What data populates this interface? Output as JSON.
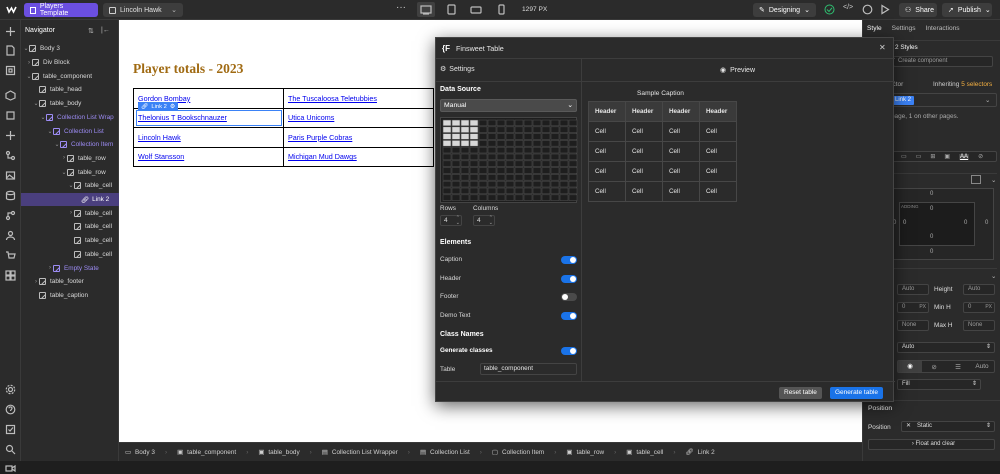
{
  "topbar": {
    "page_name": "Players Template",
    "collection_item": "Lincoln Hawk",
    "width_readout": "1297 PX",
    "mode": "Designing",
    "share_label": "Share",
    "publish_label": "Publish"
  },
  "navigator": {
    "title": "Navigator",
    "items": [
      {
        "label": "Body 3"
      },
      {
        "label": "Div Block"
      },
      {
        "label": "table_component"
      },
      {
        "label": "table_head"
      },
      {
        "label": "table_body"
      },
      {
        "label": "Collection List Wrap"
      },
      {
        "label": "Collection List"
      },
      {
        "label": "Collection Item"
      },
      {
        "label": "table_row"
      },
      {
        "label": "table_row"
      },
      {
        "label": "table_cell"
      },
      {
        "label": "Link 2"
      },
      {
        "label": "table_cell"
      },
      {
        "label": "table_cell"
      },
      {
        "label": "table_cell"
      },
      {
        "label": "table_cell"
      },
      {
        "label": "Empty State"
      },
      {
        "label": "table_footer"
      },
      {
        "label": "table_caption"
      }
    ]
  },
  "canvas": {
    "title": "Player totals - 2023",
    "selection_badge": "Link 2",
    "rows": [
      [
        "Gordon Bombay",
        "The Tuscaloosa Teletubbies"
      ],
      [
        "Thelonius T Bookschnauzer",
        "Utica Unicoms"
      ],
      [
        "Lincoln Hawk",
        "Paris Purple Cobras"
      ],
      [
        "Wolf Stansson",
        "Michigan Mud Dawgs"
      ]
    ]
  },
  "breadcrumb": [
    "Body 3",
    "table_component",
    "table_body",
    "Collection List Wrapper",
    "Collection List",
    "Collection Item",
    "table_row",
    "table_cell",
    "Link 2"
  ],
  "modal": {
    "title": "Finsweet Table",
    "settings_tab": "Settings",
    "preview_tab": "Preview",
    "data_source_label": "Data Source",
    "data_source_value": "Manual",
    "rows_label": "Rows",
    "rows_value": "4",
    "columns_label": "Columns",
    "columns_value": "4",
    "elements_label": "Elements",
    "toggles": [
      {
        "label": "Caption",
        "on": true
      },
      {
        "label": "Header",
        "on": true
      },
      {
        "label": "Footer",
        "on": false
      },
      {
        "label": "Demo Text",
        "on": true
      }
    ],
    "class_names_label": "Class Names",
    "generate_classes_label": "Generate classes",
    "generate_classes_on": true,
    "table_label": "Table",
    "table_value": "table_component",
    "preview_caption": "Sample Caption",
    "preview_headers": [
      "Header",
      "Header",
      "Header",
      "Header"
    ],
    "preview_rows": [
      [
        "Cell",
        "Cell",
        "Cell",
        "Cell"
      ],
      [
        "Cell",
        "Cell",
        "Cell",
        "Cell"
      ],
      [
        "Cell",
        "Cell",
        "Cell",
        "Cell"
      ],
      [
        "Cell",
        "Cell",
        "Cell",
        "Cell"
      ]
    ],
    "reset_label": "Reset table",
    "generate_label": "Generate table"
  },
  "right_panel": {
    "tabs": [
      "Style",
      "Settings",
      "Interactions"
    ],
    "styles_label": "2 Styles",
    "create_component": "Create component",
    "selector_label": "ector",
    "inheriting_text": "Inheriting",
    "inheriting_count": "5 selectors",
    "selector_chip": "Link 2",
    "page_note": "page, 1 on other pages.",
    "height_label": "Height",
    "min_h_label": "Min H",
    "max_h_label": "Max H",
    "auto": "Auto",
    "zero": "0",
    "px": "PX",
    "none": "None",
    "overflow_value": "Auto",
    "fit_value": "Fill",
    "position_section": "Position",
    "position_label": "Position",
    "position_value": "Static",
    "float_clear": "Float and clear",
    "padding_label": "ADDING",
    "aa_label": "AA"
  },
  "colors": {
    "accent": "#1a73e8",
    "purple": "#6b4fe0",
    "title": "#a06a12"
  }
}
